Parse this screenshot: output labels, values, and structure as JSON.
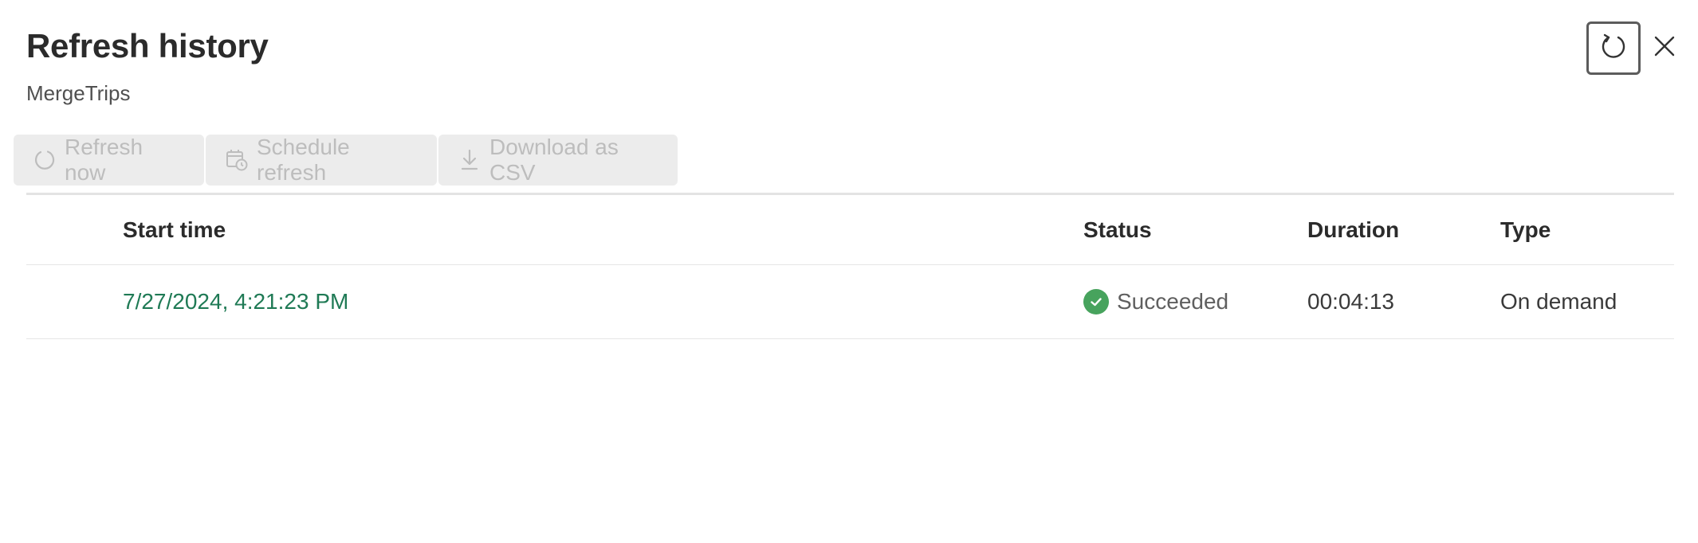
{
  "panel": {
    "title": "Refresh history",
    "subtitle": "MergeTrips"
  },
  "toolbar": {
    "refresh_now": "Refresh now",
    "schedule_refresh": "Schedule refresh",
    "download_csv": "Download as CSV"
  },
  "table": {
    "headers": [
      "Start time",
      "Status",
      "Duration",
      "Type"
    ],
    "rows": [
      {
        "start_time": "7/27/2024, 4:21:23 PM",
        "status": "Succeeded",
        "duration": "00:04:13",
        "type": "On demand"
      }
    ]
  },
  "colors": {
    "success": "#47a35d",
    "link": "#1f7a55",
    "disabled_text": "#bdbdbd",
    "disabled_bg": "#ececec"
  },
  "icons": {
    "refresh_list": "refresh-icon",
    "close": "close-icon",
    "refresh_now": "refresh-icon",
    "schedule": "calendar-clock-icon",
    "download": "download-icon",
    "status": "check-circle-icon"
  }
}
